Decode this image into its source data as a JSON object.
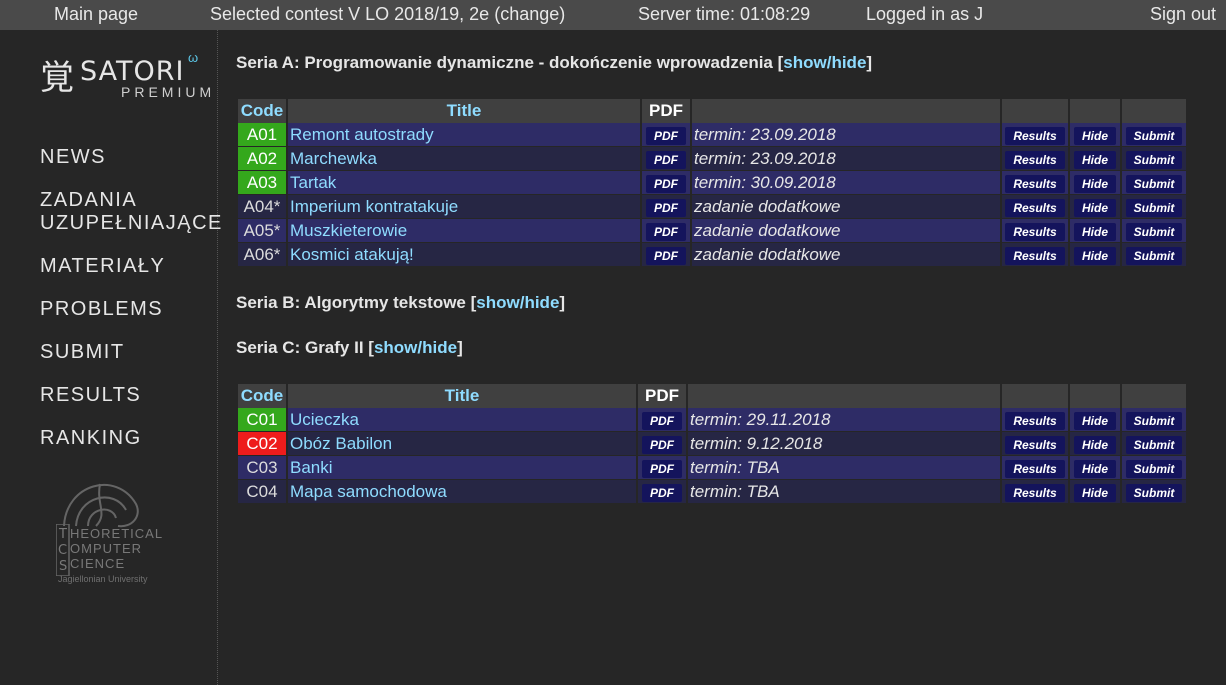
{
  "topbar": {
    "main_page": "Main page",
    "contest": "Selected contest V LO 2018/19, 2e (change)",
    "server_time": "Server time: 01:08:29",
    "logged_in": "Logged in as J",
    "sign_out": "Sign out"
  },
  "logo": {
    "kanji": "覚",
    "brand": "SATORI",
    "omega": "ω",
    "premium": "PREMIUM"
  },
  "nav": {
    "news": "NEWS",
    "zadania_line1": "ZADANIA",
    "zadania_line2": "UZUPEŁNIAJĄCE",
    "materialy": "MATERIAŁY",
    "problems": "PROBLEMS",
    "submit": "SUBMIT",
    "results": "RESULTS",
    "ranking": "RANKING"
  },
  "tcs_logo": {
    "line1": "HEORETICAL",
    "line2": "OMPUTER",
    "line3": "CIENCE",
    "university": "Jagiellonian University"
  },
  "table_headers": {
    "code": "Code",
    "title": "Title",
    "pdf": "PDF"
  },
  "buttons": {
    "pdf": "PDF",
    "results": "Results",
    "hide": "Hide",
    "submit": "Submit"
  },
  "series": [
    {
      "title": "Seria A: Programowanie dynamiczne - dokończenie wprowadzenia",
      "toggle": "show/hide",
      "tasks": [
        {
          "code": "A01",
          "title": "Remont autostrady",
          "deadline": "termin: 23.09.2018",
          "status": "ok"
        },
        {
          "code": "A02",
          "title": "Marchewka",
          "deadline": "termin: 23.09.2018",
          "status": "ok"
        },
        {
          "code": "A03",
          "title": "Tartak",
          "deadline": "termin: 30.09.2018",
          "status": "ok"
        },
        {
          "code": "A04*",
          "title": "Imperium kontratakuje",
          "deadline": "zadanie dodatkowe",
          "status": "none"
        },
        {
          "code": "A05*",
          "title": "Muszkieterowie",
          "deadline": "zadanie dodatkowe",
          "status": "none"
        },
        {
          "code": "A06*",
          "title": "Kosmici atakują!",
          "deadline": "zadanie dodatkowe",
          "status": "none"
        }
      ]
    },
    {
      "title": "Seria B: Algorytmy tekstowe",
      "toggle": "show/hide",
      "tasks": []
    },
    {
      "title": "Seria C: Grafy II",
      "toggle": "show/hide",
      "tasks": [
        {
          "code": "C01",
          "title": "Ucieczka",
          "deadline": "termin: 29.11.2018",
          "status": "ok"
        },
        {
          "code": "C02",
          "title": "Obóz Babilon",
          "deadline": "termin: 9.12.2018",
          "status": "bad"
        },
        {
          "code": "C03",
          "title": "Banki",
          "deadline": "termin: TBA",
          "status": "none"
        },
        {
          "code": "C04",
          "title": "Mapa samochodowa",
          "deadline": "termin: TBA",
          "status": "none"
        }
      ]
    }
  ],
  "colors": {
    "status_ok": "#34a81c",
    "status_bad": "#ee1c1c",
    "link": "#8fdcff"
  }
}
